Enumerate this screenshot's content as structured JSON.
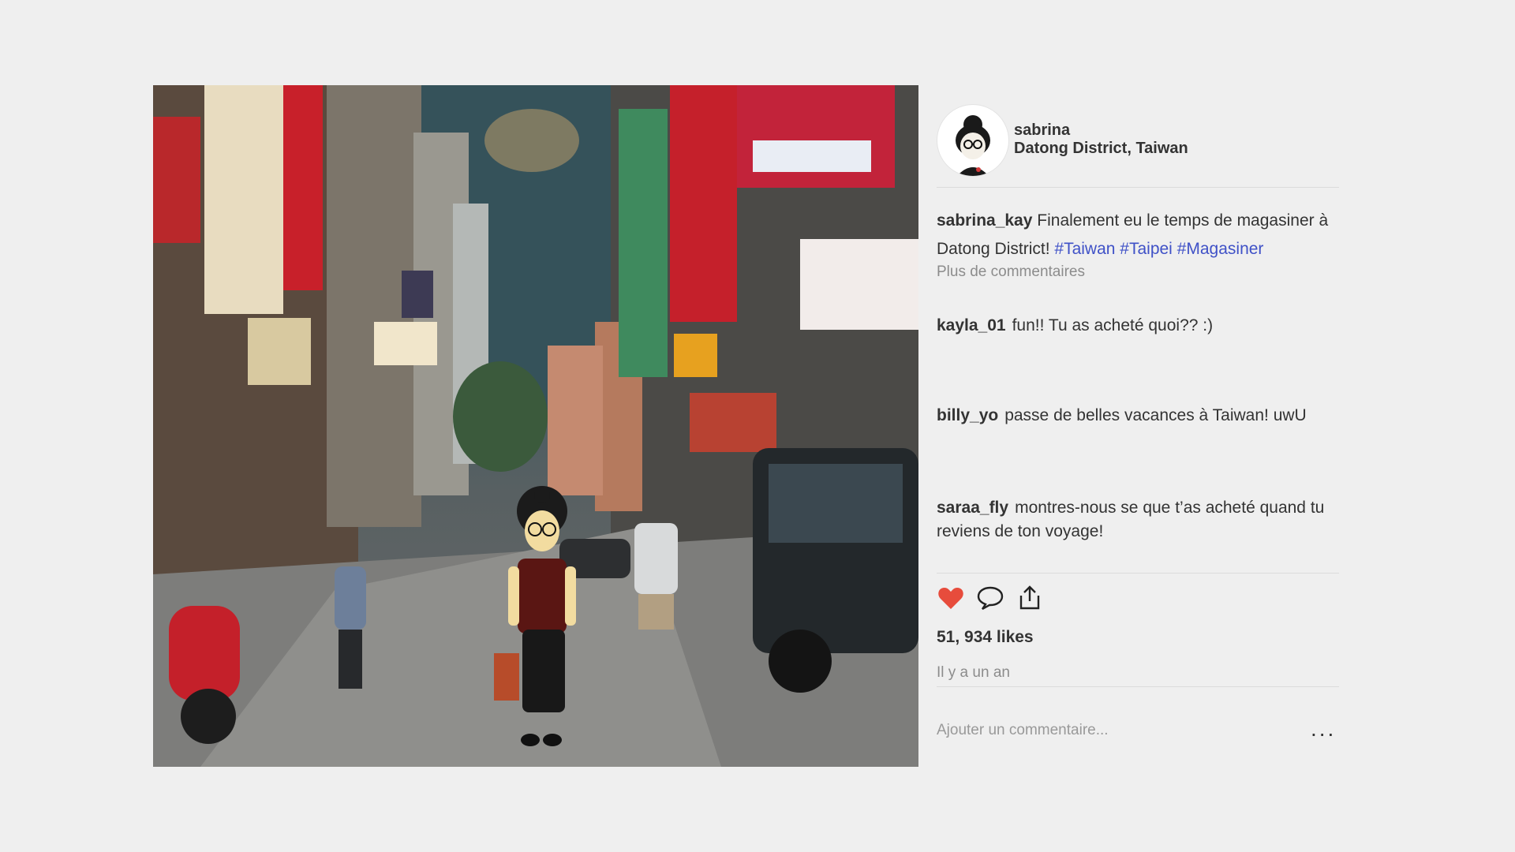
{
  "post": {
    "image_alt": "Cartoon girl shopping on a Datong District street",
    "author": {
      "username": "sabrina",
      "location": "Datong District, Taiwan"
    },
    "caption": {
      "user": "sabrina_kay",
      "text": "Finalement eu le temps de magasiner à Datong District! ",
      "hashtags": [
        "#Taiwan",
        "#Taipei",
        "#Magasiner"
      ]
    },
    "more_comments_label": "Plus de commentaires",
    "comments": [
      {
        "user": "kayla_01",
        "text": "fun!! Tu as acheté quoi?? :)"
      },
      {
        "user": "billy_yo",
        "text": "passe de belles vacances à Taiwan! uwU"
      },
      {
        "user": "saraa_fly",
        "text": "montres-nous se que t’as acheté quand tu reviens de ton voyage!"
      }
    ],
    "likes": "51, 934 likes",
    "timestamp": "Il y a un an",
    "add_comment_placeholder": "Ajouter un commentaire...",
    "more_options": "...",
    "icons": {
      "like": "heart-icon",
      "comment": "speech-bubble-icon",
      "share": "share-icon"
    },
    "colors": {
      "heart": "#e74c3c",
      "hashtag": "#3f51c7",
      "muted": "#8c8c8c"
    }
  }
}
